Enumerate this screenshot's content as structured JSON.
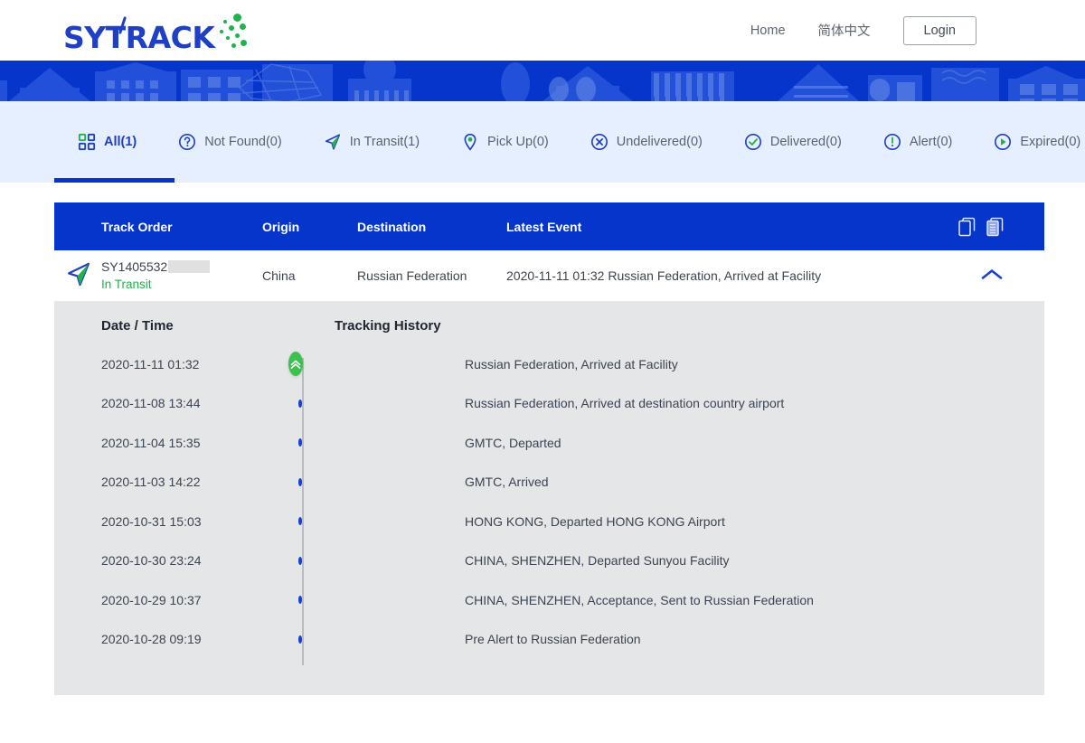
{
  "brand": {
    "name": "SYTRACK",
    "logo_blue": "#1f3fc4",
    "logo_green": "#22b14c"
  },
  "topnav": {
    "home": "Home",
    "language": "简体中文",
    "login": "Login"
  },
  "tabs": [
    {
      "label": "All(1)",
      "icon": "grid-icon",
      "active": true
    },
    {
      "label": "Not Found(0)",
      "icon": "question-icon",
      "active": false
    },
    {
      "label": "In Transit(1)",
      "icon": "navigation-icon",
      "active": false
    },
    {
      "label": "Pick Up(0)",
      "icon": "map-pin-icon",
      "active": false
    },
    {
      "label": "Undelivered(0)",
      "icon": "x-circle-icon",
      "active": false
    },
    {
      "label": "Delivered(0)",
      "icon": "check-circle-icon",
      "active": false
    },
    {
      "label": "Alert(0)",
      "icon": "alert-icon",
      "active": false
    },
    {
      "label": "Expired(0)",
      "icon": "clock-icon",
      "active": false
    }
  ],
  "table": {
    "headers": {
      "track_order": "Track Order",
      "origin": "Origin",
      "destination": "Destination",
      "latest_event": "Latest Event"
    },
    "header_icons": [
      "copy-icon",
      "documents-icon"
    ],
    "rows": [
      {
        "track_id": "SY1405532",
        "status": "In Transit",
        "origin": "China",
        "destination": "Russian Federation",
        "latest_event": "2020-11-11 01:32 Russian Federation, Arrived at Facility",
        "expanded": true
      }
    ]
  },
  "detail": {
    "col_datetime": "Date / Time",
    "col_history": "Tracking History",
    "events": [
      {
        "datetime": "2020-11-11 01:32",
        "text": "Russian Federation, Arrived at Facility",
        "marker": "current"
      },
      {
        "datetime": "2020-11-08 13:44",
        "text": "Russian Federation, Arrived at destination country airport",
        "marker": "dot"
      },
      {
        "datetime": "2020-11-04 15:35",
        "text": "GMTC, Departed",
        "marker": "dot"
      },
      {
        "datetime": "2020-11-03 14:22",
        "text": "GMTC, Arrived",
        "marker": "dot"
      },
      {
        "datetime": "2020-10-31 15:03",
        "text": "HONG KONG, Departed HONG KONG Airport",
        "marker": "dot"
      },
      {
        "datetime": "2020-10-30 23:24",
        "text": "CHINA, SHENZHEN, Departed Sunyou Facility",
        "marker": "dot"
      },
      {
        "datetime": "2020-10-29 10:37",
        "text": "CHINA, SHENZHEN, Acceptance, Sent to Russian Federation",
        "marker": "dot"
      },
      {
        "datetime": "2020-10-28 09:19",
        "text": "Pre Alert to Russian Federation",
        "marker": "dot"
      }
    ]
  },
  "colors": {
    "primary_blue": "#0635cc",
    "tabbar_bg": "#e5efff",
    "detail_bg": "#e4e6e8",
    "green": "#22b14c",
    "dot_blue": "#1740d4"
  }
}
